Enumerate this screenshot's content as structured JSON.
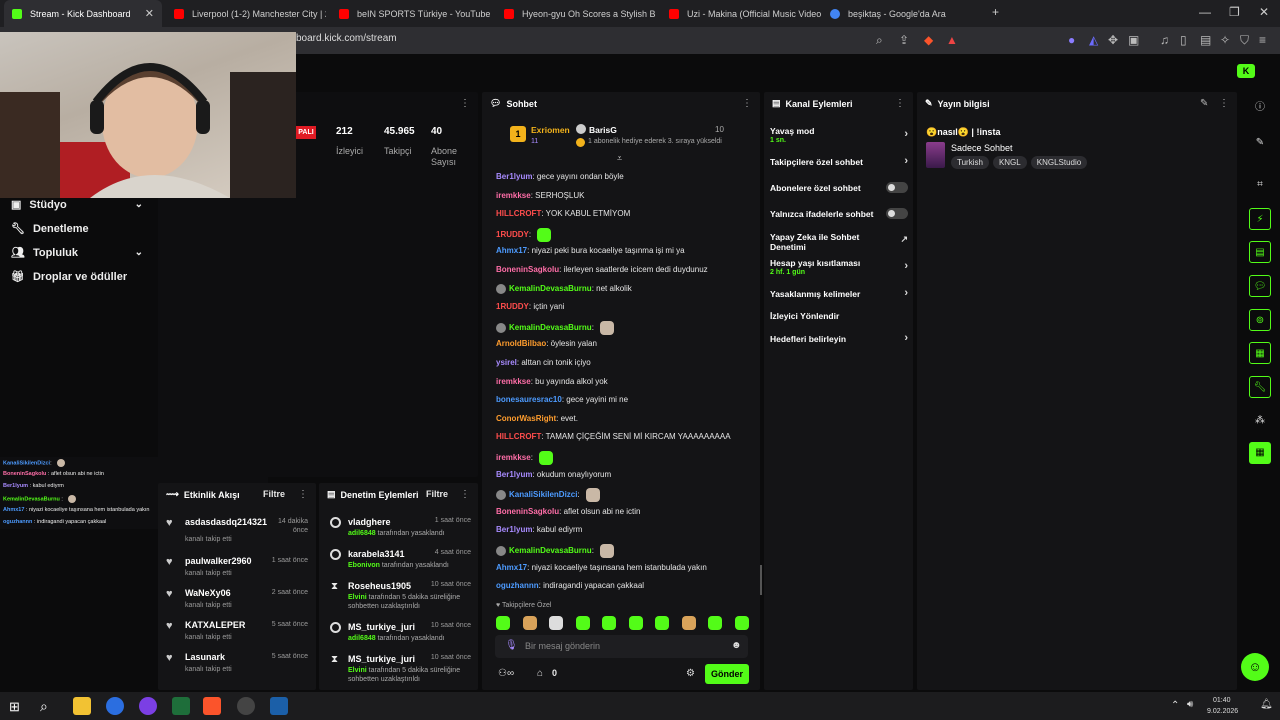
{
  "browser": {
    "tabs": [
      {
        "title": "Stream - Kick Dashboard",
        "active": true,
        "color": "#53fc18"
      },
      {
        "title": "Liverpool (1-2) Manchester City | 25.",
        "color": "#ff0000"
      },
      {
        "title": "beIN SPORTS Türkiye - YouTube",
        "color": "#ff0000"
      },
      {
        "title": "Hyeon-gyu Oh Scores a Stylish Bicycl",
        "color": "#ff0000"
      },
      {
        "title": "Uzi - Makina (Official Music Video)",
        "color": "#ff0000"
      },
      {
        "title": "beşiktaş - Google'da Ara",
        "color": "#4285f4"
      }
    ],
    "url": "board.kick.com/stream"
  },
  "nav": {
    "items": [
      {
        "label": "Stüdyo",
        "icon": "studio-icon",
        "expandable": true
      },
      {
        "label": "Denetleme",
        "icon": "wrench-icon",
        "expandable": false
      },
      {
        "label": "Topluluk",
        "icon": "people-icon",
        "expandable": true
      },
      {
        "label": "Droplar ve ödüller",
        "icon": "gift-icon",
        "expandable": false
      }
    ]
  },
  "stream_stats": {
    "status": "PALI",
    "stats": [
      {
        "value": "212",
        "label": "İzleyici"
      },
      {
        "value": "45.965",
        "label": "Takipçi"
      },
      {
        "value": "40",
        "label": "Abone Sayısı"
      }
    ]
  },
  "chat": {
    "title": "Sohbet",
    "pinned": {
      "leader": "Exriomen",
      "leader_count": "11",
      "gifter": "BarisG",
      "gifter_count": "10",
      "text": "1 abonelik hediye ederek 3. sıraya yükseldi"
    },
    "messages": [
      {
        "user": "Ber1lyum",
        "color": "#a88bff",
        "text": "gece yayını ondan böyle"
      },
      {
        "user": "iremkkse",
        "color": "#ff6ea8",
        "text": "SERHOŞLUK"
      },
      {
        "user": "HILLCROFT",
        "color": "#ff4d4d",
        "text": "YOK KABUL ETMİYOM"
      },
      {
        "user": "1RUDDY",
        "color": "#ff4d4d",
        "text": "",
        "emote": true
      },
      {
        "user": "Ahmx17",
        "color": "#4d9bff",
        "text": "niyazi peki bura kocaeliye taşınma işi mi ya"
      },
      {
        "user": "BoneninSagkolu",
        "color": "#ff6ea8",
        "text": "ilerleyen saatlerde icicem dedi duydunuz"
      },
      {
        "user": "KemalinDevasaBurnu",
        "color": "#53fc18",
        "text": "net alkolik",
        "badge": true
      },
      {
        "user": "1RUDDY",
        "color": "#ff4d4d",
        "text": "içtin yani"
      },
      {
        "user": "KemalinDevasaBurnu",
        "color": "#53fc18",
        "text": "",
        "badge": true,
        "cat": true
      },
      {
        "user": "ArnoldBilbao",
        "color": "#ff9d2e",
        "text": "öylesin yalan"
      },
      {
        "user": "ysirel",
        "color": "#a88bff",
        "text": "alttan cin tonik içiyo"
      },
      {
        "user": "iremkkse",
        "color": "#ff6ea8",
        "text": "bu yayında alkol yok"
      },
      {
        "user": "bonesauresrac10",
        "color": "#4d9bff",
        "text": "gece yayini mi ne"
      },
      {
        "user": "ConorWasRight",
        "color": "#ff9d2e",
        "text": "evet."
      },
      {
        "user": "HILLCROFT",
        "color": "#ff4d4d",
        "text": "TAMAM ÇİÇEĞİM SENİ Mİ KIRCAM YAAAAAAAAA"
      },
      {
        "user": "iremkkse",
        "color": "#ff6ea8",
        "text": "",
        "emote": true
      },
      {
        "user": "Ber1lyum",
        "color": "#a88bff",
        "text": "okudum onaylıyorum"
      },
      {
        "user": "KanaliSikilenDizci",
        "color": "#4d9bff",
        "text": "",
        "badge": true,
        "cat": true
      },
      {
        "user": "BoneninSagkolu",
        "color": "#ff6ea8",
        "text": "aflet olsun abi ne ictin"
      },
      {
        "user": "Ber1lyum",
        "color": "#a88bff",
        "text": "kabul ediyrm"
      },
      {
        "user": "KemalinDevasaBurnu",
        "color": "#53fc18",
        "text": "",
        "badge": true,
        "cat": true
      },
      {
        "user": "Ahmx17",
        "color": "#4d9bff",
        "text": "niyazi kocaeliye taşınsana hem istanbulada yakın"
      },
      {
        "user": "oguzhannn",
        "color": "#4d9bff",
        "text": "indiragandi yapacan çakkaal"
      }
    ],
    "followers_only": "Takipçilere Özel",
    "input_placeholder": "Bir mesaj gönderin",
    "send_label": "Gönder",
    "points": "0"
  },
  "channel_actions": {
    "title": "Kanal Eylemleri",
    "items": [
      {
        "label": "Yavaş mod",
        "sub": "1 sn.",
        "kind": "arrow"
      },
      {
        "label": "Takipçilere özel sohbet",
        "sub": "",
        "kind": "arrow"
      },
      {
        "label": "Abonelere özel sohbet",
        "sub": "",
        "kind": "toggle"
      },
      {
        "label": "Yalnızca ifadelerle sohbet",
        "sub": "",
        "kind": "toggle"
      },
      {
        "label": "Yapay Zeka ile Sohbet Denetimi",
        "sub": "",
        "kind": "external"
      },
      {
        "label": "Hesap yaşı kısıtlaması",
        "sub": "2 hf. 1 gün",
        "kind": "arrow"
      },
      {
        "label": "Yasaklanmış kelimeler",
        "sub": "",
        "kind": "arrow"
      },
      {
        "label": "İzleyici Yönlendir",
        "sub": "",
        "kind": "none"
      },
      {
        "label": "Hedefleri belirleyin",
        "sub": "",
        "kind": "arrow"
      }
    ]
  },
  "stream_info": {
    "title": "Yayın bilgisi",
    "stream_title": "😮nasıl😮 | !insta",
    "category": "Sadece Sohbet",
    "tags": [
      "Turkish",
      "KNGL",
      "KNGLStudio"
    ]
  },
  "activity": {
    "title": "Etkinlik Akışı",
    "filter": "Filtre",
    "items": [
      {
        "name": "asdasdasdq214321",
        "sub": "kanalı takip etti",
        "time": "14 dakika önce"
      },
      {
        "name": "paulwalker2960",
        "sub": "kanalı takip etti",
        "time": "1 saat önce"
      },
      {
        "name": "WaNeXy06",
        "sub": "kanalı takip etti",
        "time": "2 saat önce"
      },
      {
        "name": "KATXALEPER",
        "sub": "kanalı takip etti",
        "time": "5 saat önce"
      },
      {
        "name": "Lasunark",
        "sub": "kanalı takip etti",
        "time": "5 saat önce"
      }
    ]
  },
  "moderation": {
    "title": "Denetim Eylemleri",
    "filter": "Filtre",
    "items": [
      {
        "name": "vladghere",
        "by": "adil6848",
        "rest": "tarafından yasaklandı",
        "time": "1 saat önce",
        "kind": "ban"
      },
      {
        "name": "karabela3141",
        "by": "Ebonivon",
        "rest": "tarafından yasaklandı",
        "time": "4 saat önce",
        "kind": "ban"
      },
      {
        "name": "Roseheus1905",
        "by": "Elvini",
        "rest": "tarafından 5 dakika süreliğine sohbetten uzaklaştırıldı",
        "time": "10 saat önce",
        "kind": "timeout"
      },
      {
        "name": "MS_turkiye_juri",
        "by": "adil6848",
        "rest": "tarafından yasaklandı",
        "time": "10 saat önce",
        "kind": "ban"
      },
      {
        "name": "MS_turkiye_juri",
        "by": "Elvini",
        "rest": "tarafından 5 dakika süreliğine sohbetten uzaklaştırıldı",
        "time": "10 saat önce",
        "kind": "timeout"
      }
    ]
  },
  "overlay_chat": [
    {
      "user": "KanaliSikilenDizci",
      "text": ""
    },
    {
      "user": "BoneninSagkolu",
      "text": "aflet olsun abi ne ictin"
    },
    {
      "user": "Ber1lyum",
      "text": "kabul ediyrm"
    },
    {
      "user": "KemalinDevasaBurnu",
      "text": ""
    },
    {
      "user": "Ahmx17",
      "text": "niyazi kocaeliye taşınsana hem istanbulada yakın"
    },
    {
      "user": "oguzhannn",
      "text": "indiragandi yapacan çakkaal"
    }
  ],
  "taskbar": {
    "time": "01:40",
    "date": "9.02.2026"
  },
  "colors": {
    "accent": "#53fc18",
    "panel": "#141416",
    "bg": "#0b0b0c"
  }
}
